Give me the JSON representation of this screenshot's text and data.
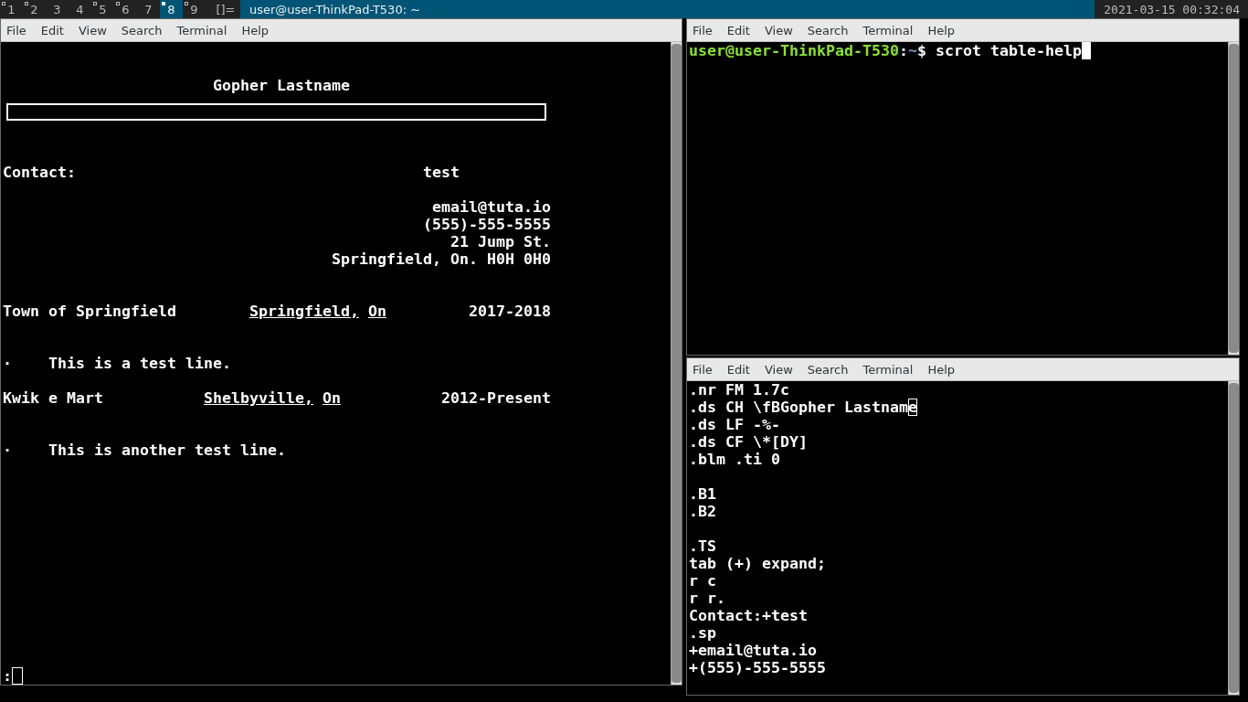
{
  "status_bar": {
    "workspaces": [
      {
        "label": "1",
        "occupied": true,
        "selected": false
      },
      {
        "label": "2",
        "occupied": true,
        "selected": false
      },
      {
        "label": "3",
        "occupied": false,
        "selected": false
      },
      {
        "label": "4",
        "occupied": false,
        "selected": false
      },
      {
        "label": "5",
        "occupied": true,
        "selected": false
      },
      {
        "label": "6",
        "occupied": true,
        "selected": false
      },
      {
        "label": "7",
        "occupied": false,
        "selected": false
      },
      {
        "label": "8",
        "occupied": true,
        "selected": true
      },
      {
        "label": "9",
        "occupied": true,
        "selected": false
      }
    ],
    "layout_symbol": "[]=",
    "window_title": "user@user-ThinkPad-T530: ~",
    "clock": "2021-03-15 00:32:04"
  },
  "windows": [
    {
      "kind": "document",
      "focused": false,
      "menu": [
        "File",
        "Edit",
        "View",
        "Search",
        "Terminal",
        "Help"
      ],
      "heading": "Gopher Lastname",
      "contact": {
        "label": "Contact:",
        "name": "test",
        "details": [
          "email@tuta.io",
          "(555)-555-5555",
          "21 Jump St.",
          "Springfield, On. H0H 0H0"
        ]
      },
      "jobs": [
        {
          "employer": "Town of Springfield",
          "city": "Springfield,",
          "province": "On",
          "years": "2017-2018",
          "bullet": "·",
          "description": "This is a test line."
        },
        {
          "employer": "Kwik e Mart",
          "city": "Shelbyville,",
          "province": "On",
          "years": "2012-Present",
          "bullet": "·",
          "description": "This is another test line."
        }
      ],
      "command_prompt": ":"
    },
    {
      "kind": "shell",
      "focused": true,
      "menu": [
        "File",
        "Edit",
        "View",
        "Search",
        "Terminal",
        "Help"
      ],
      "prompt": {
        "user_host": "user@user-ThinkPad-T530",
        "separator": ":",
        "path": "~",
        "symbol": "$",
        "command": "scrot table-help"
      }
    },
    {
      "kind": "editor",
      "focused": false,
      "menu": [
        "File",
        "Edit",
        "View",
        "Search",
        "Terminal",
        "Help"
      ],
      "blocks": [
        [
          {
            "text": ".nr FM 1.7c"
          },
          {
            "text": ".ds CH \\fBGopher Lastnam",
            "cursor": "e"
          },
          {
            "text": ".ds LF -%-"
          },
          {
            "text": ".ds CF \\*[DY]"
          },
          {
            "text": ".blm .ti 0"
          }
        ],
        [
          {
            "text": ".B1"
          },
          {
            "text": ".B2"
          }
        ],
        [
          {
            "text": ".TS"
          },
          {
            "text": "tab (+) expand;"
          },
          {
            "text": "r c"
          },
          {
            "text": "r r."
          },
          {
            "text": "Contact:+test"
          },
          {
            "text": ".sp"
          },
          {
            "text": "+email@tuta.io"
          },
          {
            "text": "+(555)-555-5555"
          }
        ]
      ]
    }
  ]
}
